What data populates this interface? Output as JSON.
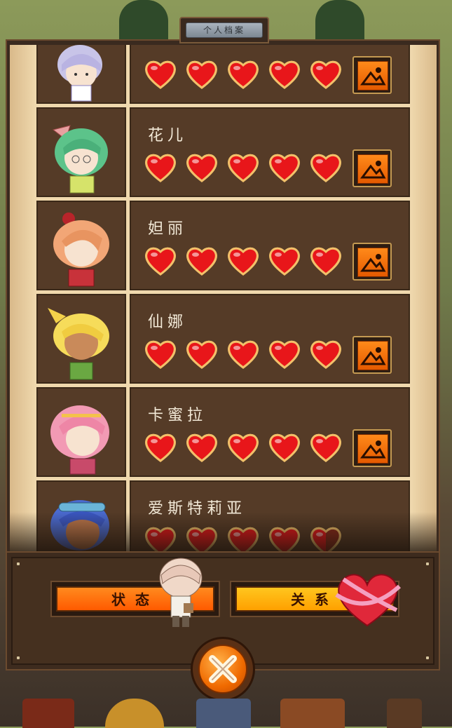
{
  "window": {
    "title": "个人档案"
  },
  "characters": [
    {
      "name": "",
      "hearts_filled": 5,
      "hearts_total": 5
    },
    {
      "name": "花儿",
      "hearts_filled": 5,
      "hearts_total": 5
    },
    {
      "name": "妲丽",
      "hearts_filled": 5,
      "hearts_total": 5
    },
    {
      "name": "仙娜",
      "hearts_filled": 5,
      "hearts_total": 5
    },
    {
      "name": "卡蜜拉",
      "hearts_filled": 5,
      "hearts_total": 5
    },
    {
      "name": "爱斯特莉亚",
      "hearts_filled": 4.5,
      "hearts_total": 5
    }
  ],
  "tabs": {
    "status_label": "状态",
    "relation_label": "关系"
  },
  "colors": {
    "heart": "#e8161a",
    "button_orange": "#ff6a00",
    "button_yellow": "#ffb000",
    "panel": "#553b27"
  },
  "icons": {
    "gallery": "image-gallery-icon",
    "close": "close-x-icon",
    "relation": "ribbon-heart-icon"
  }
}
